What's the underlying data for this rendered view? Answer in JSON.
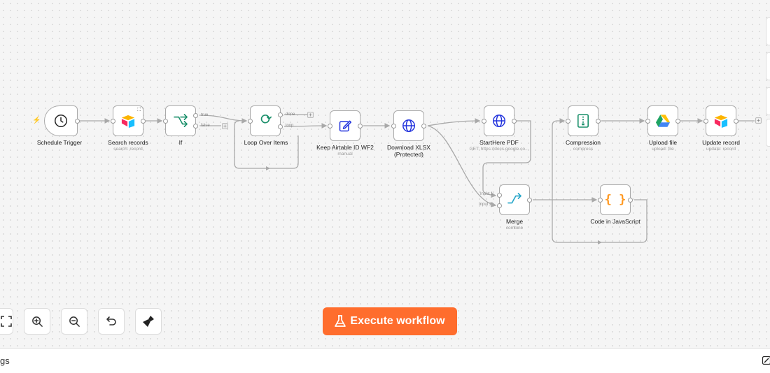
{
  "nodes": {
    "schedule_trigger": {
      "label": "Schedule Trigger",
      "icon": "clock-icon"
    },
    "search_records": {
      "label": "Search records",
      "sub": "search: record",
      "icon": "airtable-icon"
    },
    "if": {
      "label": "If",
      "icon": "branch-icon",
      "out_true": "true",
      "out_false": "false"
    },
    "loop_over_items": {
      "label": "Loop Over Items",
      "icon": "loop-icon",
      "out_done": "done",
      "out_loop": "loop"
    },
    "keep_airtable_id": {
      "label": "Keep Airtable ID WF2",
      "sub": "manual",
      "icon": "edit-icon"
    },
    "download_xlsx": {
      "label": "Download XLSX (Protected)",
      "icon": "globe-icon"
    },
    "starthere_pdf": {
      "label": "StartHere PDF",
      "sub": "GET: https://docs.google.co...",
      "icon": "globe-icon"
    },
    "merge": {
      "label": "Merge",
      "sub": "combine",
      "icon": "merge-icon",
      "in_1": "Input 1",
      "in_2": "Input 2"
    },
    "code_js": {
      "label": "Code in JavaScript",
      "icon": "code-icon"
    },
    "compression": {
      "label": "Compression",
      "sub": "compress",
      "icon": "zip-icon"
    },
    "upload_file": {
      "label": "Upload file",
      "sub": "upload: file",
      "icon": "google-drive-icon"
    },
    "update_record": {
      "label": "Update record",
      "sub": "update: record",
      "icon": "airtable-icon"
    }
  },
  "toolbar": {
    "execute_label": "Execute workflow",
    "buttons": [
      "fit-view-icon",
      "zoom-in-icon",
      "zoom-out-icon",
      "undo-icon",
      "tidy-up-icon"
    ]
  },
  "bottom": {
    "text": "gs"
  },
  "colors": {
    "accent": "#ff6d2d",
    "edge": "#a9a9a9",
    "canvas": "#f5f5f5"
  }
}
